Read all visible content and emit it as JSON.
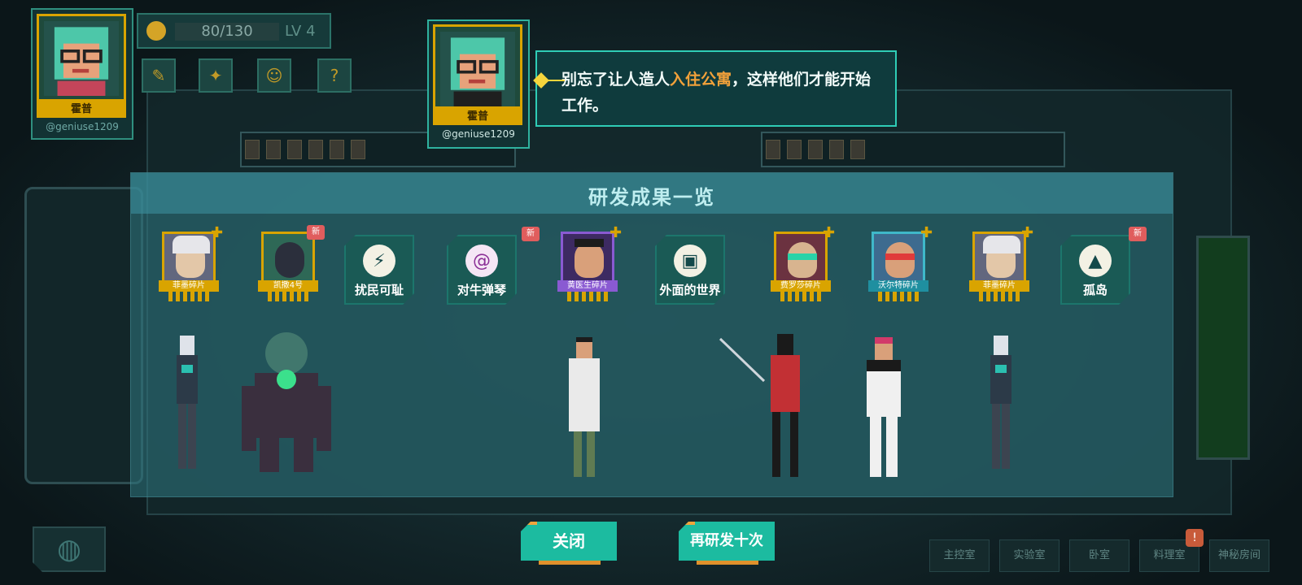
{
  "player": {
    "name": "霍普",
    "handle": "@geniuse1209"
  },
  "hud": {
    "xp": "80/130",
    "level_label": "LV",
    "level_value": "4"
  },
  "toolbar": {
    "icons": [
      "notes-icon",
      "flashlight-icon",
      "smile-icon",
      "help-icon"
    ],
    "help_glyph": "?"
  },
  "dialogue": {
    "speaker": "霍普",
    "handle": "@geniuse1209",
    "text_before": "别忘了让人造人",
    "text_highlight": "入住公寓",
    "text_after": "，这样他们才能开始工作。"
  },
  "results": {
    "title": "研发成果一览",
    "items": [
      {
        "kind": "portrait",
        "label": "菲墨碎片",
        "new": false,
        "plus": true
      },
      {
        "kind": "portrait",
        "label": "凯撒4号",
        "new": true,
        "plus": false
      },
      {
        "kind": "card",
        "label": "扰民可耻",
        "icon": "lightning-icon",
        "glyph": "⚡",
        "new": false
      },
      {
        "kind": "card",
        "label": "对牛弹琴",
        "icon": "spiral-icon",
        "glyph": "@",
        "new": true,
        "color": "purple"
      },
      {
        "kind": "portrait",
        "label": "黄医生碎片",
        "new": false,
        "plus": true
      },
      {
        "kind": "card",
        "label": "外面的世界",
        "icon": "suitcase-icon",
        "glyph": "▣",
        "new": false
      },
      {
        "kind": "portrait",
        "label": "费罗莎碎片",
        "new": false,
        "plus": true
      },
      {
        "kind": "portrait",
        "label": "沃尔特碎片",
        "new": false,
        "plus": true
      },
      {
        "kind": "portrait",
        "label": "菲墨碎片",
        "new": false,
        "plus": true
      },
      {
        "kind": "card",
        "label": "孤岛",
        "icon": "island-icon",
        "glyph": "▲",
        "new": true
      }
    ],
    "new_tag": "新"
  },
  "buttons": {
    "close": "关闭",
    "research_again": "再研发十次"
  },
  "rooms": {
    "items": [
      "主控室",
      "实验室",
      "卧室",
      "料理室",
      "神秘房间"
    ],
    "alert": "!"
  },
  "colors": {
    "accent": "#1cbba0",
    "highlight": "#f2a13a",
    "frame_gold": "#d9a400"
  }
}
